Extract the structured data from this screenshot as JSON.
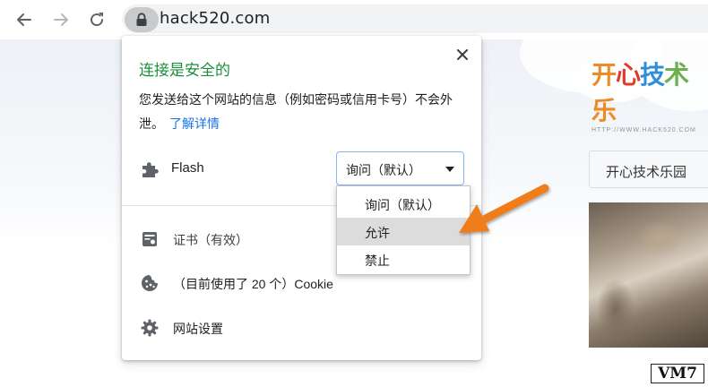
{
  "toolbar": {
    "url": "hack520.com"
  },
  "page": {
    "site_logo": {
      "chars": [
        "开",
        "心",
        "技",
        "术",
        "乐"
      ],
      "sub": "HTTP://WWW.HACK520.COM"
    },
    "nav_tab": "开心技术乐园",
    "watermark": "VM7"
  },
  "popup": {
    "title": "连接是安全的",
    "description": "您发送给这个网站的信息（例如密码或信用卡号）不会外泄。",
    "learn_more": "了解详情",
    "permission": {
      "name": "Flash",
      "icon": "puzzle-piece-icon",
      "selected": "询问（默认）"
    },
    "info_rows": [
      {
        "icon": "certificate-icon",
        "label": "证书（有效）"
      },
      {
        "icon": "cookie-icon",
        "label": "（目前使用了 20 个）Cookie"
      },
      {
        "icon": "gear-icon",
        "label": "网站设置"
      }
    ]
  },
  "dropdown": {
    "options": [
      "询问（默认）",
      "允许",
      "禁止"
    ],
    "highlighted_index": 1
  },
  "colors": {
    "secure_title": "#1e8e3e",
    "link": "#1a73e8",
    "arrow": "#f07d1a"
  }
}
